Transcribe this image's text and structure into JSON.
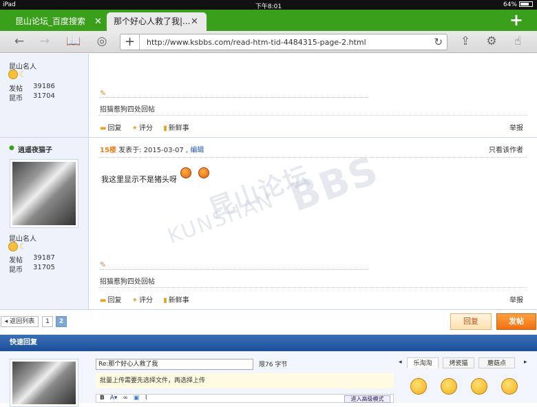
{
  "status_bar": {
    "device": "iPad",
    "time": "下午8:01",
    "battery": "64%",
    "battery_level": 0.64
  },
  "tabs": [
    {
      "label": "昆山论坛_百度搜索",
      "active": false
    },
    {
      "label": "那个好心人救了我|...",
      "active": true
    }
  ],
  "toolbar": {
    "url": "http://www.ksbbs.com/read-htm-tid-4484315-page-2.html"
  },
  "posts": [
    {
      "user_title": "昆山名人",
      "stats": [
        {
          "label": "发帖",
          "value": "39186"
        },
        {
          "label": "昆币",
          "value": "31704"
        }
      ],
      "signature": "招猫惹狗四处回帖",
      "actions": [
        "回复",
        "评分",
        "新鲜事"
      ],
      "report": "举报"
    },
    {
      "username": "逍遥夜猫子",
      "floor": "15楼",
      "posted_label": "发表于: 2015-03-07 ,",
      "edit_label": "编辑",
      "author_only": "只看该作者",
      "content": "我这里显示不是猪头呀",
      "user_title": "昆山名人",
      "stats": [
        {
          "label": "发帖",
          "value": "39187"
        },
        {
          "label": "昆币",
          "value": "31705"
        }
      ],
      "signature": "招猫惹狗四处回帖",
      "actions": [
        "回复",
        "评分",
        "新鲜事"
      ],
      "report": "举报"
    }
  ],
  "watermark": {
    "line1": "昆山论坛",
    "line2": "KUNSHAN",
    "line3": "BBS"
  },
  "pager": {
    "back": "返回列表",
    "pages": [
      "1",
      "2"
    ],
    "current": "2",
    "reply": "回复",
    "post": "发帖"
  },
  "quick_reply": {
    "header": "快速回复",
    "title_value": "Re:那个好心人救了我",
    "limit": "限76 字节",
    "notice": "批量上传需要先选择文件，再选择上传",
    "advanced": "进入高级模式",
    "emoji_tabs": [
      "乐淘淘",
      "烤瓷猫",
      "蘑菇点"
    ],
    "active_emoji_tab": "乐淘淘"
  },
  "colors": {
    "tab_green": "#3aa01c",
    "header_blue": "#1d4f99",
    "accent_orange": "#f07010"
  }
}
